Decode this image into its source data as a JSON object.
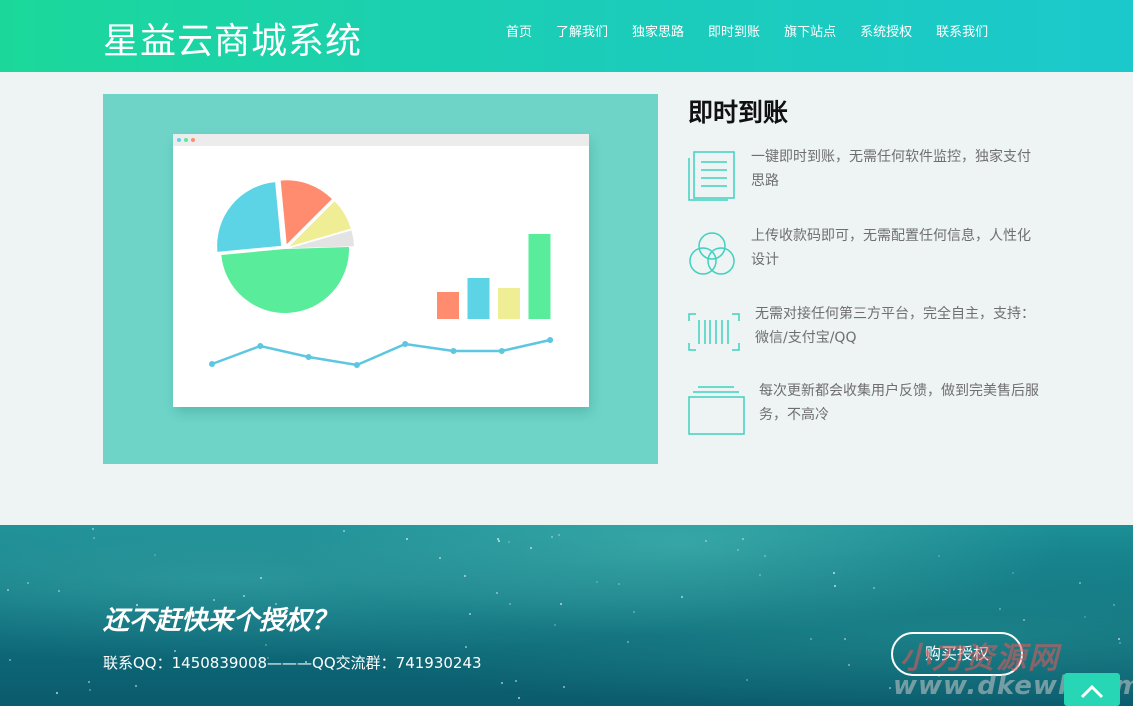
{
  "header": {
    "brand": "星益云商城系统",
    "nav": [
      "首页",
      "了解我们",
      "独家思路",
      "即时到账",
      "旗下站点",
      "系统授权",
      "联系我们"
    ]
  },
  "feature": {
    "title": "即时到账",
    "items": [
      {
        "icon": "document-list-icon",
        "text": "一键即时到账，无需任何软件监控，独家支付思路"
      },
      {
        "icon": "circles-icon",
        "text": "上传收款码即可，无需配置任何信息，人性化设计"
      },
      {
        "icon": "barcode-icon",
        "text": "无需对接任何第三方平台，完全自主，支持：微信/支付宝/QQ"
      },
      {
        "icon": "stack-icon",
        "text": "每次更新都会收集用户反馈，做到完美售后服务，不高冷"
      }
    ]
  },
  "illustration_chart": {
    "type": "dashboard-illustration",
    "pie": [
      {
        "color": "#59ec9a",
        "share": 0.49
      },
      {
        "color": "#5dd3e6",
        "share": 0.25
      },
      {
        "color": "#ff8c6e",
        "share": 0.14
      },
      {
        "color": "#f0ee94",
        "share": 0.08
      },
      {
        "color": "#e3e3e3",
        "share": 0.04
      }
    ],
    "bars": [
      {
        "color": "#ff8c6e",
        "value": 27
      },
      {
        "color": "#5dd3e6",
        "value": 41
      },
      {
        "color": "#f0ee94",
        "value": 31
      },
      {
        "color": "#59ec9a",
        "value": 85
      }
    ],
    "line": [
      40,
      58,
      47,
      39,
      60,
      53,
      53,
      64
    ],
    "line_color": "#5dc6e0"
  },
  "banner": {
    "title": "还不赶快来个授权？",
    "contact": "联系QQ：1450839008———QQ交流群：741930243",
    "buy_label": "购买授权",
    "watermark_cn": "小刀资源网",
    "watermark_en": "www.dkewl.com"
  },
  "colors": {
    "header_start": "#1bd89a",
    "header_end": "#1bc9cc",
    "illustration_bg": "#6fd4c8",
    "icon_stroke": "#3fd1bf"
  }
}
